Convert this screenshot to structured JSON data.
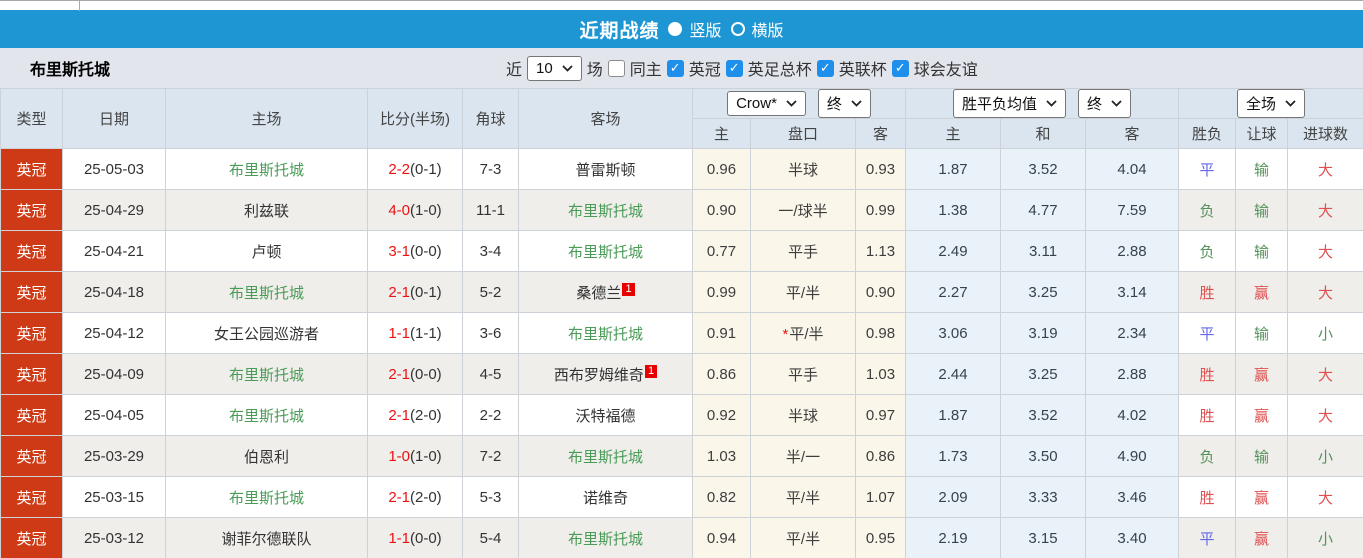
{
  "colors": {
    "title_bar_blue": "#1e96d4",
    "league_badge_red": "#ce3a15",
    "team_highlight_green": "#4a9b57",
    "score_red": "#ec1212",
    "result_win_red": "#e05050",
    "result_lose_green": "#55925a",
    "result_draw_blue": "#6467e8",
    "odds_cream_bg": "#fbf6ea",
    "odds_blue_bg": "#e9f2f9",
    "header_bg": "#dae5ef"
  },
  "title_bar": {
    "title": "近期战绩",
    "radio_vertical": "竖版",
    "radio_horizontal": "横版"
  },
  "toolbar": {
    "team_name": "布里斯托城",
    "recent_label": "近",
    "recent_count": "10",
    "matches_label": "场",
    "same_home_label": "同主",
    "filters": [
      {
        "label": "英冠",
        "checked": true
      },
      {
        "label": "英足总杯",
        "checked": true
      },
      {
        "label": "英联杯",
        "checked": true
      },
      {
        "label": "球会友谊",
        "checked": true
      }
    ]
  },
  "table": {
    "headers": {
      "type": "类型",
      "date": "日期",
      "home": "主场",
      "score": "比分(半场)",
      "corners": "角球",
      "away": "客场",
      "odds_home": "主",
      "odds_line": "盘口",
      "odds_away": "客",
      "wdl_home": "主",
      "wdl_draw": "和",
      "wdl_away": "客",
      "result": "胜负",
      "handicap": "让球",
      "goals": "进球数",
      "bookmaker_select": "Crow*",
      "final_select_1": "终",
      "wdl_select": "胜平负均值",
      "final_select_2": "终",
      "fulltime_select": "全场"
    },
    "rows": [
      {
        "type": "英冠",
        "date": "25-05-03",
        "home": "布里斯托城",
        "home_green": true,
        "score": "2-2",
        "half": "(0-1)",
        "corners": "7-3",
        "away": "普雷斯顿",
        "away_green": false,
        "away_sup": "",
        "odds_home": "0.96",
        "line_star": "",
        "line": "半球",
        "odds_away": "0.93",
        "wdl_home": "1.87",
        "wdl_draw": "3.52",
        "wdl_away": "4.04",
        "result": "平",
        "result_color": "blue",
        "handicap": "输",
        "handicap_color": "green",
        "goals": "大",
        "goals_color": "red"
      },
      {
        "type": "英冠",
        "date": "25-04-29",
        "home": "利兹联",
        "home_green": false,
        "score": "4-0",
        "half": "(1-0)",
        "corners": "11-1",
        "away": "布里斯托城",
        "away_green": true,
        "away_sup": "",
        "odds_home": "0.90",
        "line_star": "",
        "line": "一/球半",
        "odds_away": "0.99",
        "wdl_home": "1.38",
        "wdl_draw": "4.77",
        "wdl_away": "7.59",
        "result": "负",
        "result_color": "green",
        "handicap": "输",
        "handicap_color": "green",
        "goals": "大",
        "goals_color": "red"
      },
      {
        "type": "英冠",
        "date": "25-04-21",
        "home": "卢顿",
        "home_green": false,
        "score": "3-1",
        "half": "(0-0)",
        "corners": "3-4",
        "away": "布里斯托城",
        "away_green": true,
        "away_sup": "",
        "odds_home": "0.77",
        "line_star": "",
        "line": "平手",
        "odds_away": "1.13",
        "wdl_home": "2.49",
        "wdl_draw": "3.11",
        "wdl_away": "2.88",
        "result": "负",
        "result_color": "green",
        "handicap": "输",
        "handicap_color": "green",
        "goals": "大",
        "goals_color": "red"
      },
      {
        "type": "英冠",
        "date": "25-04-18",
        "home": "布里斯托城",
        "home_green": true,
        "score": "2-1",
        "half": "(0-1)",
        "corners": "5-2",
        "away": "桑德兰",
        "away_green": false,
        "away_sup": "1",
        "odds_home": "0.99",
        "line_star": "",
        "line": "平/半",
        "odds_away": "0.90",
        "wdl_home": "2.27",
        "wdl_draw": "3.25",
        "wdl_away": "3.14",
        "result": "胜",
        "result_color": "red",
        "handicap": "赢",
        "handicap_color": "red",
        "goals": "大",
        "goals_color": "red"
      },
      {
        "type": "英冠",
        "date": "25-04-12",
        "home": "女王公园巡游者",
        "home_green": false,
        "score": "1-1",
        "half": "(1-1)",
        "corners": "3-6",
        "away": "布里斯托城",
        "away_green": true,
        "away_sup": "",
        "odds_home": "0.91",
        "line_star": "*",
        "line": "平/半",
        "odds_away": "0.98",
        "wdl_home": "3.06",
        "wdl_draw": "3.19",
        "wdl_away": "2.34",
        "result": "平",
        "result_color": "blue",
        "handicap": "输",
        "handicap_color": "green",
        "goals": "小",
        "goals_color": "green"
      },
      {
        "type": "英冠",
        "date": "25-04-09",
        "home": "布里斯托城",
        "home_green": true,
        "score": "2-1",
        "half": "(0-0)",
        "corners": "4-5",
        "away": "西布罗姆维奇",
        "away_green": false,
        "away_sup": "1",
        "odds_home": "0.86",
        "line_star": "",
        "line": "平手",
        "odds_away": "1.03",
        "wdl_home": "2.44",
        "wdl_draw": "3.25",
        "wdl_away": "2.88",
        "result": "胜",
        "result_color": "red",
        "handicap": "赢",
        "handicap_color": "red",
        "goals": "大",
        "goals_color": "red"
      },
      {
        "type": "英冠",
        "date": "25-04-05",
        "home": "布里斯托城",
        "home_green": true,
        "score": "2-1",
        "half": "(2-0)",
        "corners": "2-2",
        "away": "沃特福德",
        "away_green": false,
        "away_sup": "",
        "odds_home": "0.92",
        "line_star": "",
        "line": "半球",
        "odds_away": "0.97",
        "wdl_home": "1.87",
        "wdl_draw": "3.52",
        "wdl_away": "4.02",
        "result": "胜",
        "result_color": "red",
        "handicap": "赢",
        "handicap_color": "red",
        "goals": "大",
        "goals_color": "red"
      },
      {
        "type": "英冠",
        "date": "25-03-29",
        "home": "伯恩利",
        "home_green": false,
        "score": "1-0",
        "half": "(1-0)",
        "corners": "7-2",
        "away": "布里斯托城",
        "away_green": true,
        "away_sup": "",
        "odds_home": "1.03",
        "line_star": "",
        "line": "半/一",
        "odds_away": "0.86",
        "wdl_home": "1.73",
        "wdl_draw": "3.50",
        "wdl_away": "4.90",
        "result": "负",
        "result_color": "green",
        "handicap": "输",
        "handicap_color": "green",
        "goals": "小",
        "goals_color": "green"
      },
      {
        "type": "英冠",
        "date": "25-03-15",
        "home": "布里斯托城",
        "home_green": true,
        "score": "2-1",
        "half": "(2-0)",
        "corners": "5-3",
        "away": "诺维奇",
        "away_green": false,
        "away_sup": "",
        "odds_home": "0.82",
        "line_star": "",
        "line": "平/半",
        "odds_away": "1.07",
        "wdl_home": "2.09",
        "wdl_draw": "3.33",
        "wdl_away": "3.46",
        "result": "胜",
        "result_color": "red",
        "handicap": "赢",
        "handicap_color": "red",
        "goals": "大",
        "goals_color": "red"
      },
      {
        "type": "英冠",
        "date": "25-03-12",
        "home": "谢菲尔德联队",
        "home_green": false,
        "score": "1-1",
        "half": "(0-0)",
        "corners": "5-4",
        "away": "布里斯托城",
        "away_green": true,
        "away_sup": "",
        "odds_home": "0.94",
        "line_star": "",
        "line": "平/半",
        "odds_away": "0.95",
        "wdl_home": "2.19",
        "wdl_draw": "3.15",
        "wdl_away": "3.40",
        "result": "平",
        "result_color": "blue",
        "handicap": "赢",
        "handicap_color": "red",
        "goals": "小",
        "goals_color": "green"
      }
    ]
  }
}
